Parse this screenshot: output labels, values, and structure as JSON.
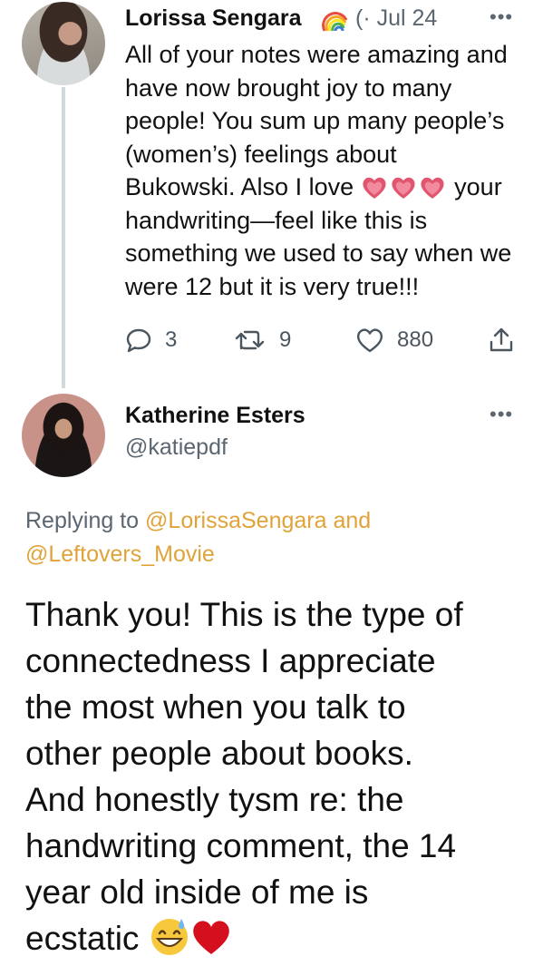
{
  "first_tweet": {
    "author_name": "Lorissa Sengara",
    "meta": "(· Jul 24",
    "more": "•••",
    "body_lines": [
      "All of your notes were amazing and",
      "have now brought joy to many",
      "people! You sum up many people’s",
      "(women’s) feelings about",
      "Bukowski. Also I love",
      "your",
      "handwriting—feel like this is",
      "something we used to say when we",
      "were 12 but it is very true!!!"
    ],
    "actions": {
      "replies": "3",
      "retweets": "9",
      "likes": "880"
    },
    "colors": {
      "heart": "#e0566e",
      "secondary_text": "#5b6670"
    }
  },
  "second_tweet": {
    "author_name": "Katherine Esters",
    "handle": "@katiepdf",
    "more": "•••",
    "replying_prefix": "Replying to ",
    "mention_1": "@LorissaSengara",
    "replying_and": " and",
    "mention_2": "@Leftovers_Movie",
    "body_lines": [
      "Thank you! This is the type of",
      "connectedness I appreciate",
      "the most when you talk to",
      "other people about books.",
      "And honestly tysm re: the",
      "handwriting comment, the 14",
      "year old inside of me is",
      "ecstatic"
    ],
    "colors": {
      "mention": "#e0a33a"
    }
  }
}
